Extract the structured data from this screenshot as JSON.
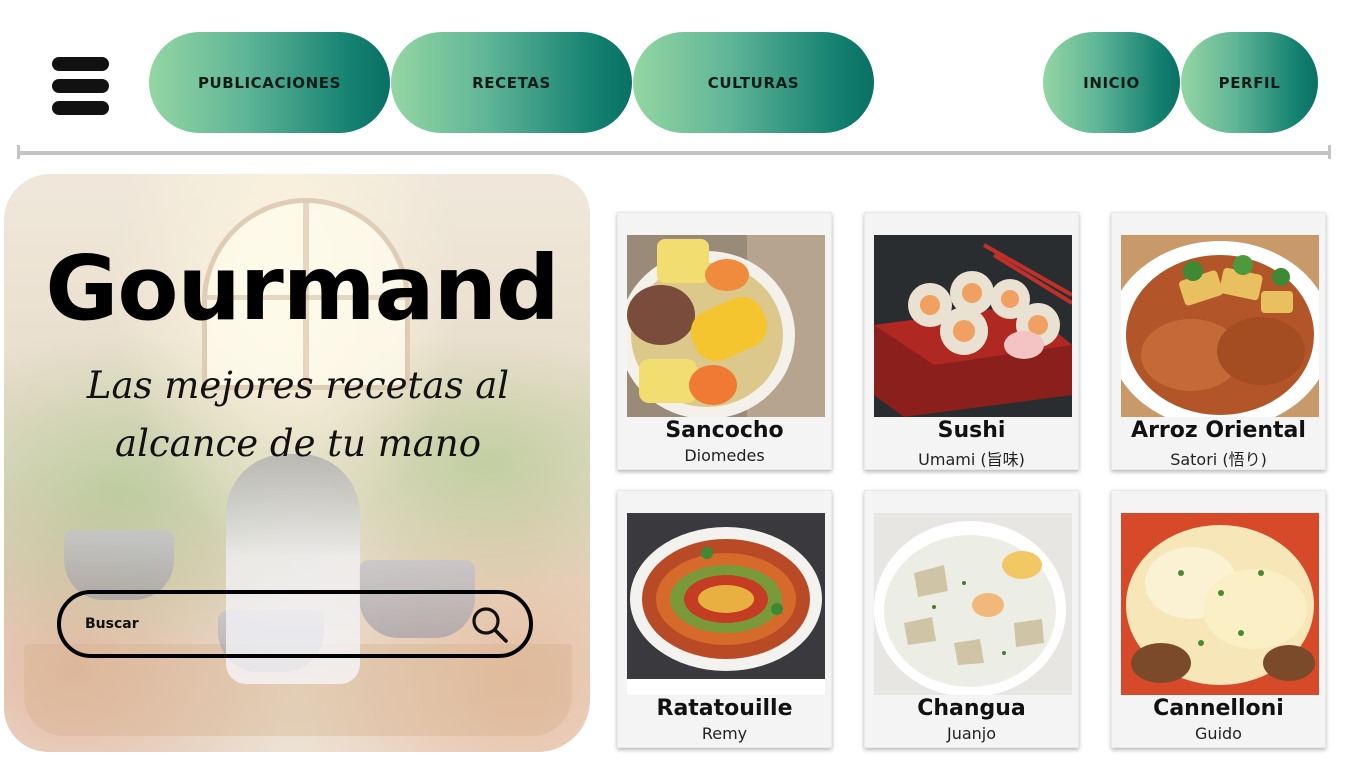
{
  "nav": {
    "menu_icon": "hamburger-icon",
    "items": [
      {
        "label": "PUBLICACIONES"
      },
      {
        "label": "RECETAS"
      },
      {
        "label": "CULTURAS"
      },
      {
        "label": "INICIO"
      },
      {
        "label": "PERFIL"
      }
    ],
    "gradient_start": "#94d6a3",
    "gradient_end": "#0a7064"
  },
  "hero": {
    "title": "Gourmand",
    "subtitle_line1": "Las mejores recetas al",
    "subtitle_line2": "alcance de tu mano",
    "image_icon": "chef-rat-kitchen-illustration"
  },
  "search": {
    "placeholder": "Buscar",
    "icon": "search-icon"
  },
  "recipes": [
    {
      "name": "Sancocho",
      "chef": "Diomedes",
      "icon": "sancocho-photo"
    },
    {
      "name": "Sushi",
      "chef": "Umami (旨味)",
      "icon": "sushi-photo"
    },
    {
      "name": "Arroz Oriental",
      "chef": "Satori (悟り)",
      "icon": "arroz-oriental-photo"
    },
    {
      "name": "Ratatouille",
      "chef": "Remy",
      "icon": "ratatouille-photo"
    },
    {
      "name": "Changua",
      "chef": "Juanjo",
      "icon": "changua-photo"
    },
    {
      "name": "Cannelloni",
      "chef": "Guido",
      "icon": "cannelloni-photo"
    }
  ]
}
